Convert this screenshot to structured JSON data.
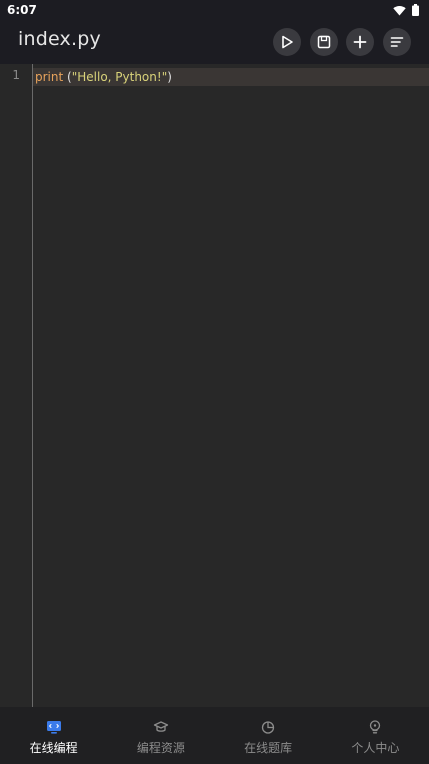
{
  "status_bar": {
    "time": "6:07"
  },
  "header": {
    "filename": "index.py",
    "actions": [
      {
        "name": "run",
        "icon": "play-icon"
      },
      {
        "name": "save",
        "icon": "save-icon"
      },
      {
        "name": "new",
        "icon": "plus-icon"
      },
      {
        "name": "format",
        "icon": "align-left-icon"
      }
    ]
  },
  "editor": {
    "lines": [
      {
        "number": "1",
        "keyword": "print",
        "space": " ",
        "open_paren": "(",
        "string": "\"Hello, Python!\"",
        "close_paren": ")"
      }
    ]
  },
  "bottom_nav": {
    "items": [
      {
        "label": "在线编程",
        "icon": "code-monitor-icon",
        "active": true
      },
      {
        "label": "编程资源",
        "icon": "graduation-cap-icon",
        "active": false
      },
      {
        "label": "在线题库",
        "icon": "pie-chart-icon",
        "active": false
      },
      {
        "label": "个人中心",
        "icon": "lightbulb-icon",
        "active": false
      }
    ]
  },
  "colors": {
    "accent": "#3b7bea",
    "keyword": "#e8a35c",
    "string": "#d9d37a",
    "background": "#282828",
    "toolbar": "#1c1c22"
  }
}
